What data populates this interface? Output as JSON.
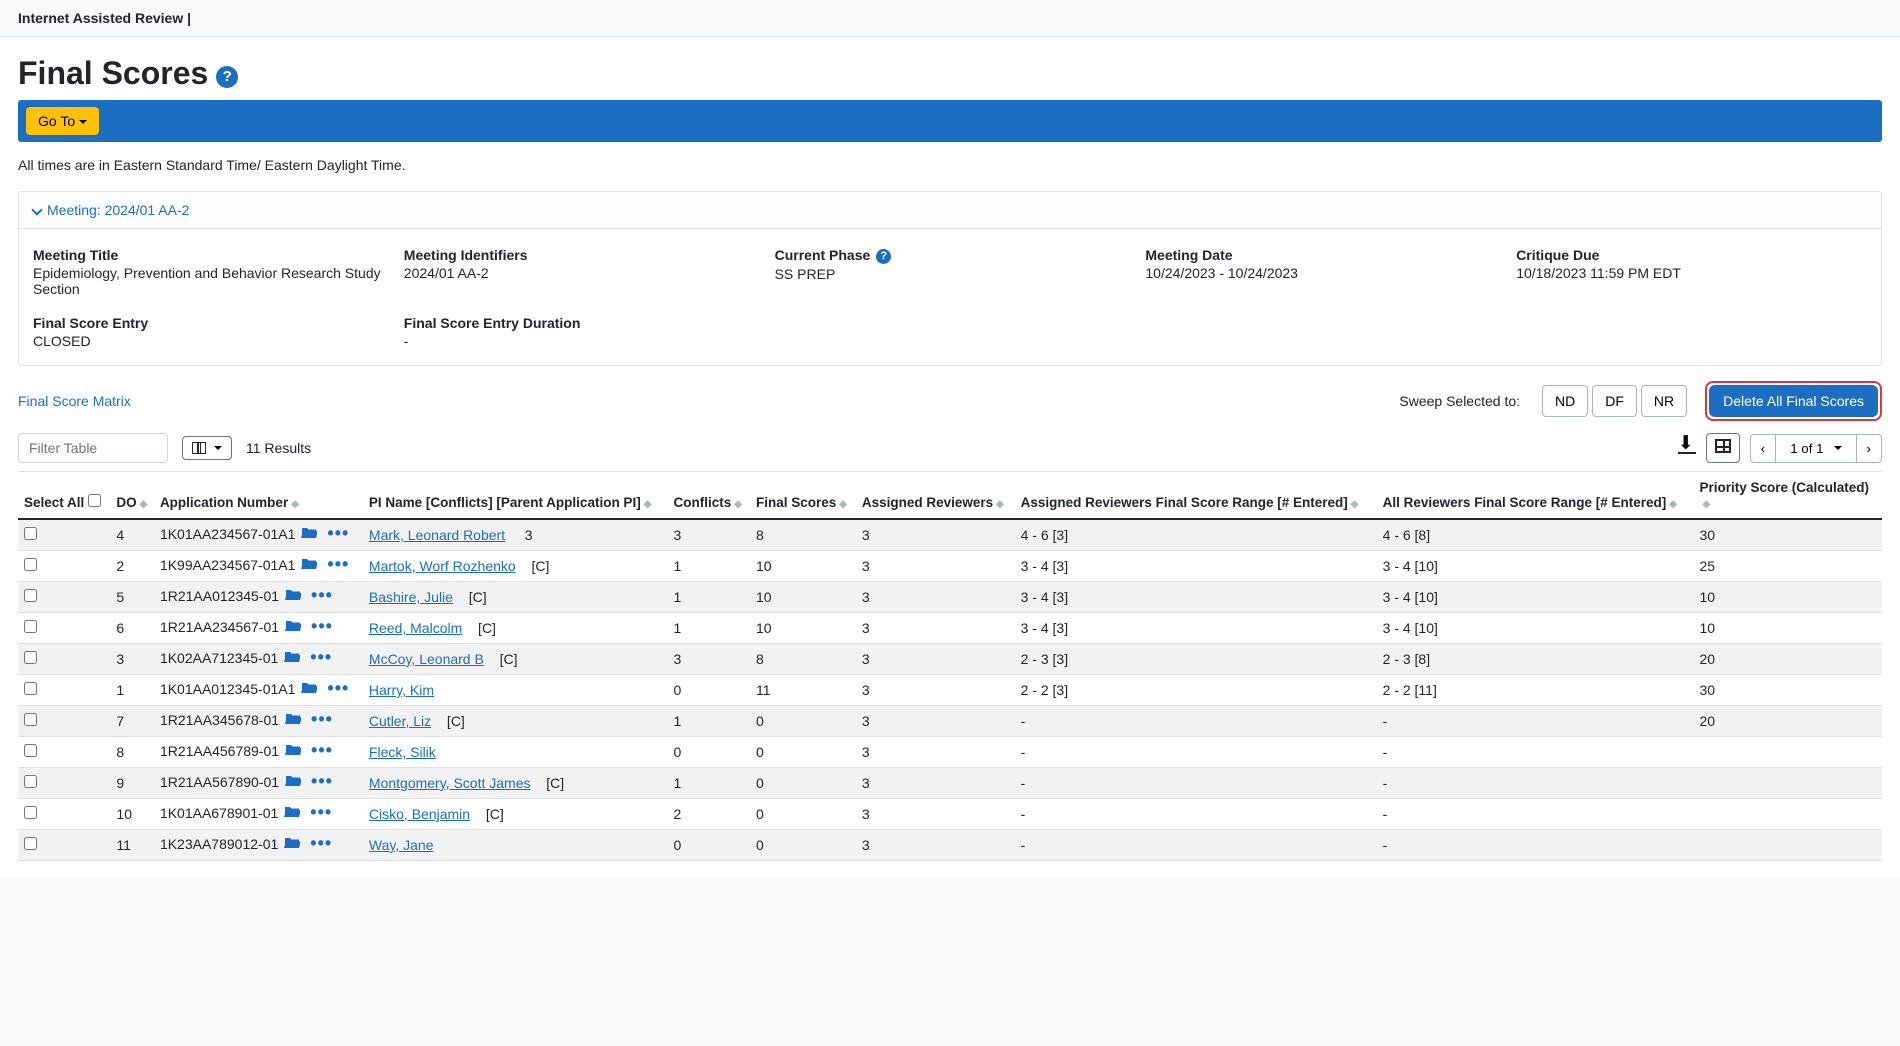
{
  "topBar": {
    "title": "Internet Assisted Review"
  },
  "page": {
    "title": "Final Scores",
    "gotoButton": "Go To",
    "tzNote": "All times are in Eastern Standard Time/ Eastern Daylight Time.",
    "meetingHeader": "Meeting:  2024/01 AA-2",
    "filterPlaceholder": "Filter Table",
    "resultsText": "11 Results",
    "finalScoreMatrix": "Final Score Matrix",
    "sweepLabel": "Sweep Selected to:",
    "sweepButtons": {
      "nd": "ND",
      "df": "DF",
      "nr": "NR"
    },
    "deleteAll": "Delete All Final Scores",
    "pager": "1 of 1"
  },
  "meetingDetails": {
    "titleLabel": "Meeting Title",
    "titleValue": "Epidemiology, Prevention and Behavior Research Study Section",
    "identifiersLabel": "Meeting Identifiers",
    "identifiersValue": "2024/01 AA-2",
    "phaseLabel": "Current Phase",
    "phaseValue": "SS PREP",
    "dateLabel": "Meeting Date",
    "dateValue": "10/24/2023 - 10/24/2023",
    "critiqueLabel": "Critique Due",
    "critiqueValue": "10/18/2023 11:59 PM EDT",
    "entryLabel": "Final Score Entry",
    "entryValue": "CLOSED",
    "durationLabel": "Final Score Entry Duration",
    "durationValue": "-"
  },
  "columns": {
    "selectAll": "Select All",
    "do": "DO",
    "appNum": "Application Number",
    "piName": "PI Name [Conflicts] [Parent Application PI]",
    "conflicts": "Conflicts",
    "finalScores": "Final Scores",
    "assignedReviewers": "Assigned Reviewers",
    "assignedRange": "Assigned Reviewers Final Score Range [# Entered]",
    "allRange": "All Reviewers Final Score Range [# Entered]",
    "priority": "Priority Score (Calculated)"
  },
  "rows": [
    {
      "do": "4",
      "app": "1K01AA234567-01A1",
      "pi": "Mark, Leonard Robert",
      "conflictCount": "3",
      "conflicts": "3",
      "final": "8",
      "assigned": "3",
      "assignedRange": "4 - 6 [3]",
      "allRange": "4 - 6 [8]",
      "priority": "30"
    },
    {
      "do": "2",
      "app": "1K99AA234567-01A1",
      "pi": "Martok, Worf Rozhenko",
      "conflictTag": "[C]",
      "conflicts": "1",
      "final": "10",
      "assigned": "3",
      "assignedRange": "3 - 4 [3]",
      "allRange": "3 - 4 [10]",
      "priority": "25"
    },
    {
      "do": "5",
      "app": "1R21AA012345-01",
      "pi": "Bashire, Julie",
      "conflictTag": "[C]",
      "conflicts": "1",
      "final": "10",
      "assigned": "3",
      "assignedRange": "3 - 4 [3]",
      "allRange": "3 - 4 [10]",
      "priority": "10"
    },
    {
      "do": "6",
      "app": "1R21AA234567-01",
      "pi": "Reed, Malcolm",
      "conflictTag": "[C]",
      "conflicts": "1",
      "final": "10",
      "assigned": "3",
      "assignedRange": "3 - 4 [3]",
      "allRange": "3 - 4 [10]",
      "priority": "10"
    },
    {
      "do": "3",
      "app": "1K02AA712345-01",
      "pi": "McCoy, Leonard B",
      "conflictTag": "[C]",
      "conflicts": "3",
      "final": "8",
      "assigned": "3",
      "assignedRange": "2 - 3 [3]",
      "allRange": "2 - 3 [8]",
      "priority": "20"
    },
    {
      "do": "1",
      "app": "1K01AA012345-01A1",
      "pi": "Harry, Kim",
      "conflicts": "0",
      "final": "11",
      "assigned": "3",
      "assignedRange": "2 - 2 [3]",
      "allRange": "2 - 2 [11]",
      "priority": "30"
    },
    {
      "do": "7",
      "app": "1R21AA345678-01",
      "pi": "Cutler, Liz",
      "conflictTag": "[C]",
      "conflicts": "1",
      "final": "0",
      "assigned": "3",
      "assignedRange": "-",
      "allRange": "-",
      "priority": "20"
    },
    {
      "do": "8",
      "app": "1R21AA456789-01",
      "pi": "Fleck, Silik",
      "conflicts": "0",
      "final": "0",
      "assigned": "3",
      "assignedRange": "-",
      "allRange": "-",
      "priority": ""
    },
    {
      "do": "9",
      "app": "1R21AA567890-01",
      "pi": "Montgomery, Scott James",
      "conflictTag": "[C]",
      "conflicts": "1",
      "final": "0",
      "assigned": "3",
      "assignedRange": "-",
      "allRange": "-",
      "priority": ""
    },
    {
      "do": "10",
      "app": "1K01AA678901-01",
      "pi": "Cisko, Benjamin",
      "conflictTag": "[C]",
      "conflicts": "2",
      "final": "0",
      "assigned": "3",
      "assignedRange": "-",
      "allRange": "-",
      "priority": ""
    },
    {
      "do": "11",
      "app": "1K23AA789012-01",
      "pi": "Way, Jane",
      "conflicts": "0",
      "final": "0",
      "assigned": "3",
      "assignedRange": "-",
      "allRange": "-",
      "priority": ""
    }
  ]
}
